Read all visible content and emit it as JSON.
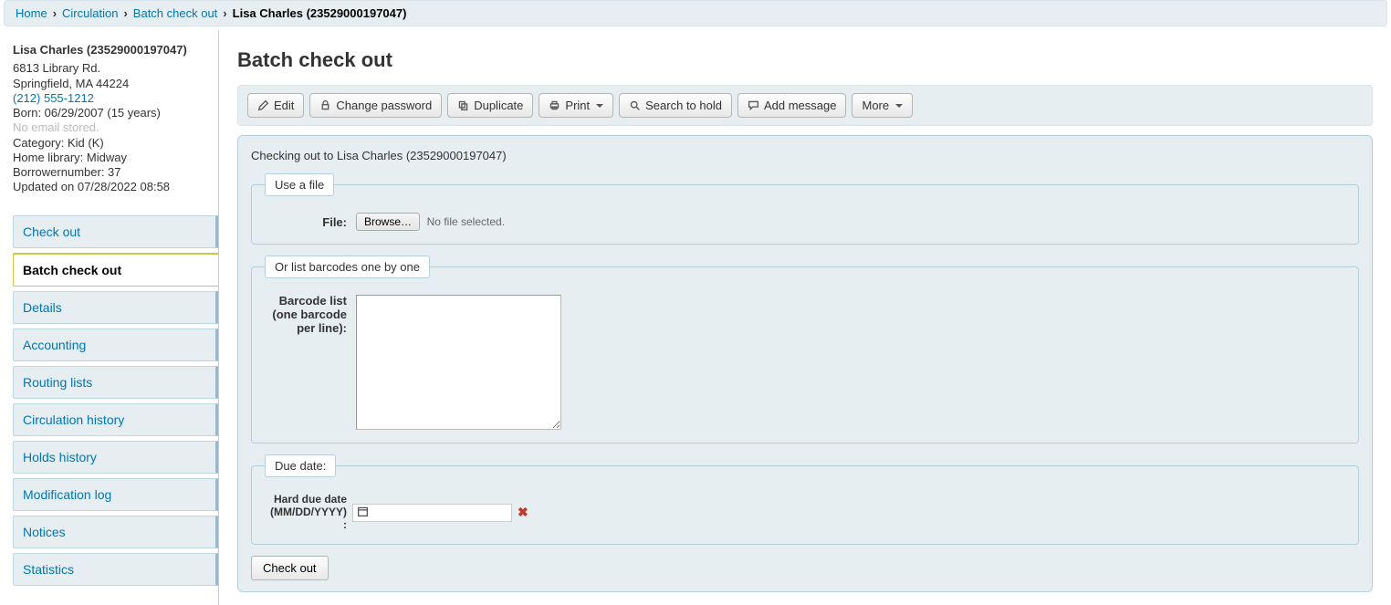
{
  "breadcrumb": {
    "home": "Home",
    "circulation": "Circulation",
    "batch": "Batch check out",
    "current": "Lisa Charles (23529000197047)"
  },
  "patron": {
    "name": "Lisa Charles (23529000197047)",
    "address1": "6813 Library Rd.",
    "address2": "Springfield, MA 44224",
    "phone": "(212) 555-1212",
    "born": "Born: 06/29/2007 (15 years)",
    "email": "No email stored.",
    "category": "Category: Kid (K)",
    "home_library": "Home library: Midway",
    "borrower_num": "Borrowernumber: 37",
    "updated": "Updated on 07/28/2022 08:58"
  },
  "sidebar": {
    "items": [
      {
        "label": "Check out"
      },
      {
        "label": "Batch check out"
      },
      {
        "label": "Details"
      },
      {
        "label": "Accounting"
      },
      {
        "label": "Routing lists"
      },
      {
        "label": "Circulation history"
      },
      {
        "label": "Holds history"
      },
      {
        "label": "Modification log"
      },
      {
        "label": "Notices"
      },
      {
        "label": "Statistics"
      }
    ]
  },
  "page_title": "Batch check out",
  "toolbar": {
    "edit": "Edit",
    "change_password": "Change password",
    "duplicate": "Duplicate",
    "print": "Print",
    "search_to_hold": "Search to hold",
    "add_message": "Add message",
    "more": "More"
  },
  "form": {
    "checking_to": "Checking out to Lisa Charles (23529000197047)",
    "use_a_file_legend": "Use a file",
    "file_label": "File:",
    "browse_label": "Browse…",
    "no_file_selected": "No file selected.",
    "barcode_legend": "Or list barcodes one by one",
    "barcode_label": "Barcode list (one barcode per line):",
    "barcode_value": "",
    "due_legend": "Due date:",
    "due_label": "Hard due date (MM/DD/YYYY) :",
    "due_value": "",
    "submit": "Check out"
  }
}
